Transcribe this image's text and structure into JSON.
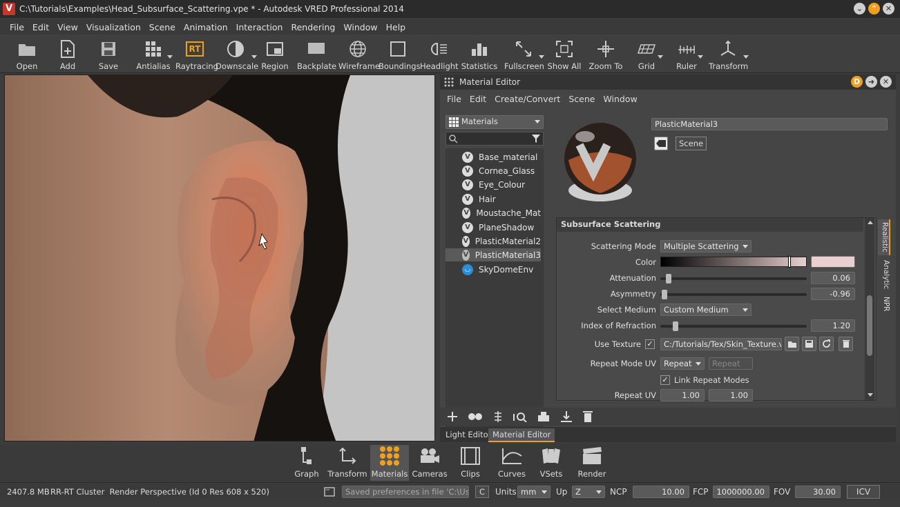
{
  "app": {
    "title": "C:\\Tutorials\\Examples\\Head_Subsurface_Scattering.vpe * - Autodesk VRED Professional 2014",
    "logo_letter": "V"
  },
  "menu": [
    "File",
    "Edit",
    "View",
    "Visualization",
    "Scene",
    "Animation",
    "Interaction",
    "Rendering",
    "Window",
    "Help"
  ],
  "toolbar": {
    "open": "Open",
    "add": "Add",
    "save": "Save",
    "antialias": "Antialias",
    "rt_badge": "RT",
    "raytracing": "Raytracing",
    "downscale": "Downscale",
    "region": "Region",
    "backplate": "Backplate",
    "wireframe": "Wireframe",
    "boundings": "Boundings",
    "headlight": "Headlight",
    "statistics": "Statistics",
    "fullscreen": "Fullscreen",
    "showall": "Show All",
    "zoomto": "Zoom To",
    "grid": "Grid",
    "ruler": "Ruler",
    "transform": "Transform"
  },
  "material_editor": {
    "title": "Material Editor",
    "menu": [
      "File",
      "Edit",
      "Create/Convert",
      "Scene",
      "Window"
    ],
    "filter_combo": "Materials",
    "tree": [
      {
        "label": "Base_material",
        "selected": false
      },
      {
        "label": "Cornea_Glass",
        "selected": false
      },
      {
        "label": "Eye_Colour",
        "selected": false
      },
      {
        "label": "Hair",
        "selected": false
      },
      {
        "label": "Moustache_Mat",
        "selected": false
      },
      {
        "label": "PlaneShadow",
        "selected": false
      },
      {
        "label": "PlasticMaterial2",
        "selected": false
      },
      {
        "label": "PlasticMaterial3",
        "selected": true
      },
      {
        "label": "SkyDomeEnv",
        "selected": false
      }
    ],
    "material_name": "PlasticMaterial3",
    "scene_button": "Scene",
    "section_title": "Subsurface Scattering",
    "props": {
      "scattering_mode_label": "Scattering Mode",
      "scattering_mode_value": "Multiple Scattering",
      "color_label": "Color",
      "color_swatch": "#e9cfcf",
      "attenuation_label": "Attenuation",
      "attenuation_value": "0.06",
      "asymmetry_label": "Asymmetry",
      "asymmetry_value": "-0.96",
      "select_medium_label": "Select Medium",
      "select_medium_value": "Custom Medium",
      "ior_label": "Index of Refraction",
      "ior_value": "1.20",
      "use_texture_label": "Use Texture",
      "texture_path": "C:/Tutorials/Tex/Skin_Texture.vif",
      "repeat_mode_label": "Repeat Mode UV",
      "repeat_mode_value": "Repeat",
      "repeat_mode_value2": "Repeat",
      "link_repeat_label": "Link Repeat Modes",
      "repeat_uv_label": "Repeat UV",
      "repeat_u": "1.00",
      "repeat_v": "1.00"
    },
    "side_tabs": [
      "Realistic",
      "Analytic",
      "NPR"
    ],
    "bottom_tabs": [
      "Light Editor",
      "Material Editor"
    ]
  },
  "dock": [
    "Graph",
    "Transform",
    "Materials",
    "Cameras",
    "Clips",
    "Curves",
    "VSets",
    "Render"
  ],
  "status": {
    "memory": "2407.8 MB",
    "info": "RR-RT Cluster  Render Perspective (Id 0 Res 608 x 520)",
    "message": "Saved preferences in file 'C:\\Us...",
    "c_button": "C",
    "units_label": "Units",
    "units_value": "mm",
    "up_label": "Up",
    "up_value": "Z",
    "ncp_label": "NCP",
    "ncp_value": "10.00",
    "fcp_label": "FCP",
    "fcp_value": "1000000.00",
    "fov_label": "FOV",
    "fov_value": "30.00",
    "icv_button": "ICV"
  },
  "colors": {
    "accent": "#f0a020",
    "panel": "#454545"
  }
}
